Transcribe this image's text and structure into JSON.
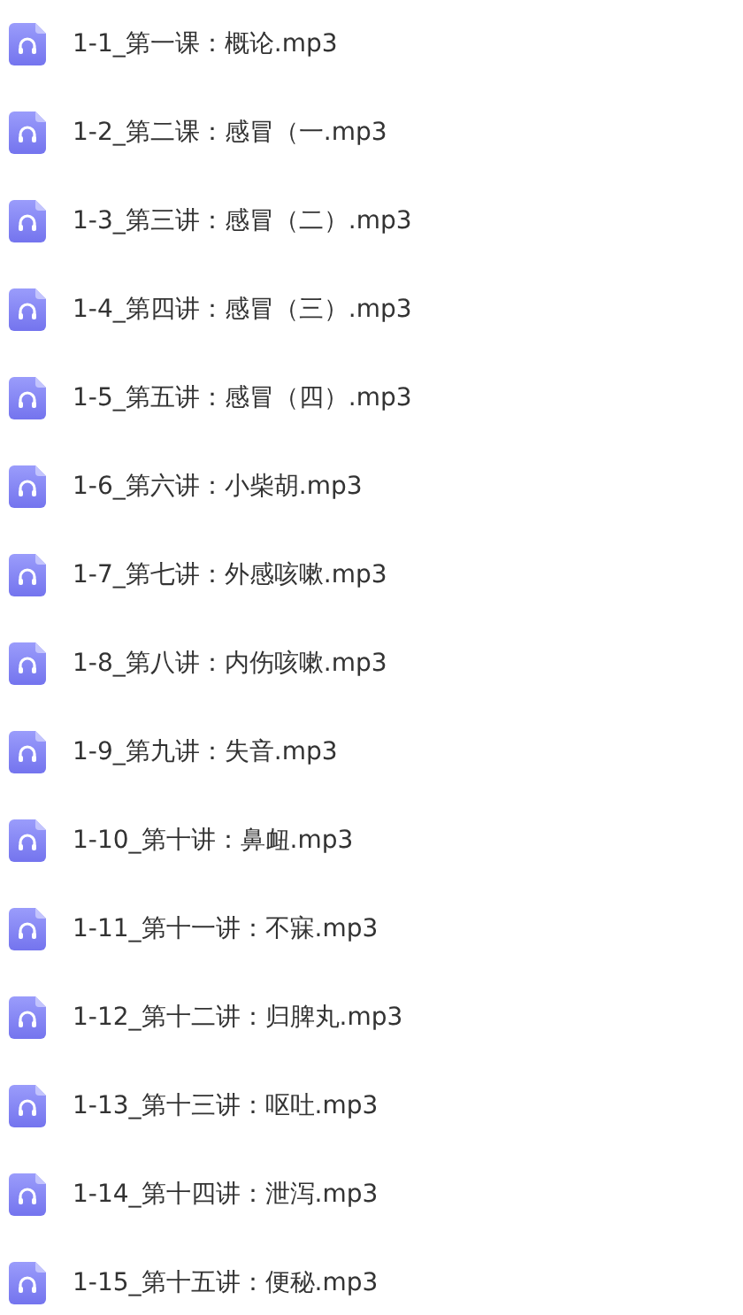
{
  "files": [
    {
      "name": "1-1_第一课：概论.mp3"
    },
    {
      "name": "1-2_第二课：感冒（一.mp3"
    },
    {
      "name": "1-3_第三讲：感冒（二）.mp3"
    },
    {
      "name": "1-4_第四讲：感冒（三）.mp3"
    },
    {
      "name": "1-5_第五讲：感冒（四）.mp3"
    },
    {
      "name": "1-6_第六讲：小柴胡.mp3"
    },
    {
      "name": "1-7_第七讲：外感咳嗽.mp3"
    },
    {
      "name": "1-8_第八讲：内伤咳嗽.mp3"
    },
    {
      "name": "1-9_第九讲：失音.mp3"
    },
    {
      "name": "1-10_第十讲：鼻衄.mp3"
    },
    {
      "name": "1-11_第十一讲：不寐.mp3"
    },
    {
      "name": "1-12_第十二讲：归脾丸.mp3"
    },
    {
      "name": "1-13_第十三讲：呕吐.mp3"
    },
    {
      "name": "1-14_第十四讲：泄泻.mp3"
    },
    {
      "name": "1-15_第十五讲：便秘.mp3"
    }
  ]
}
